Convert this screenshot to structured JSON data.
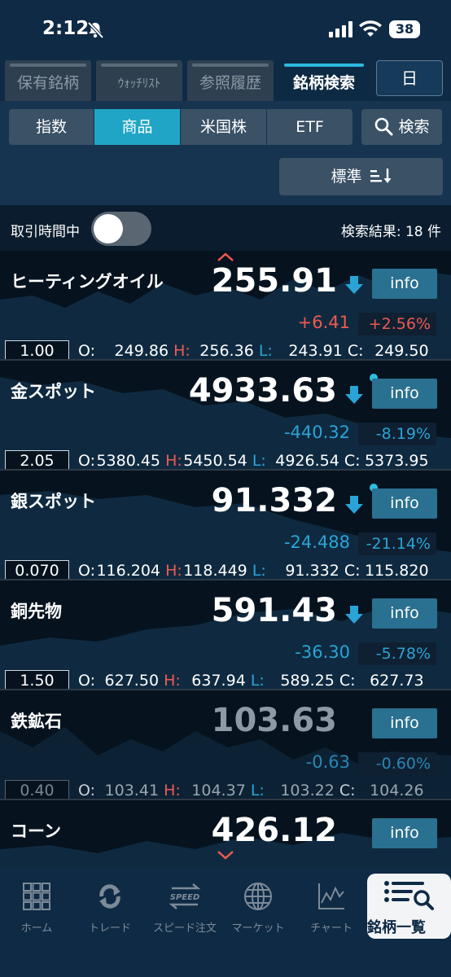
{
  "status_bar": {
    "time": "2:12",
    "battery": "38"
  },
  "tabs": [
    {
      "label": "保有銘柄"
    },
    {
      "label": "ｳｫｯﾁﾘｽﾄ"
    },
    {
      "label": "参照履歴"
    },
    {
      "label": "銘柄検索"
    }
  ],
  "day_button": "日",
  "segments": [
    {
      "label": "指数"
    },
    {
      "label": "商品"
    },
    {
      "label": "米国株"
    },
    {
      "label": "ETF"
    }
  ],
  "search_button": "検索",
  "sort_button": "標準",
  "trading_hours_label": "取引時間中",
  "trading_hours_on": false,
  "result_count": "検索結果: 18 件",
  "colors": {
    "up": "#ef5a50",
    "down": "#2aa4d6",
    "accent": "#21a5c6"
  },
  "rows": [
    {
      "name": "ヒーティングオイル",
      "price": "255.91",
      "change": "+6.41",
      "pct": "+2.56%",
      "multiplier": "1.00",
      "o": "249.86",
      "h": "256.36",
      "l": "243.91",
      "c": "249.50",
      "info": "info"
    },
    {
      "name": "金スポット",
      "price": "4933.63",
      "change": "-440.32",
      "pct": "-8.19%",
      "multiplier": "2.05",
      "o": "5380.45",
      "h": "5450.54",
      "l": "4926.54",
      "c": "5373.95",
      "info": "info"
    },
    {
      "name": "銀スポット",
      "price": "91.332",
      "change": "-24.488",
      "pct": "-21.14%",
      "multiplier": "0.070",
      "o": "116.204",
      "h": "118.449",
      "l": "91.332",
      "c": "115.820",
      "info": "info"
    },
    {
      "name": "銅先物",
      "price": "591.43",
      "change": "-36.30",
      "pct": "-5.78%",
      "multiplier": "1.50",
      "o": "627.50",
      "h": "637.94",
      "l": "589.25",
      "c": "627.73",
      "info": "info"
    },
    {
      "name": "鉄鉱石",
      "price": "103.63",
      "change": "-0.63",
      "pct": "-0.60%",
      "multiplier": "0.40",
      "o": "103.41",
      "h": "104.37",
      "l": "103.22",
      "c": "104.26",
      "info": "info"
    },
    {
      "name": "コーン",
      "price": "426.12",
      "info": "info"
    }
  ],
  "ohlc_keys": {
    "o": "O:",
    "h": "H:",
    "l": "L:",
    "c": "C:"
  },
  "bottom_nav": [
    {
      "label": "ホーム",
      "icon": "home-grid-icon"
    },
    {
      "label": "トレード",
      "icon": "trade-arrows-icon"
    },
    {
      "label": "スピード注文",
      "icon": "speed-icon"
    },
    {
      "label": "マーケット",
      "icon": "globe-icon"
    },
    {
      "label": "チャート",
      "icon": "chart-icon"
    },
    {
      "label": "銘柄一覧",
      "icon": "list-search-icon"
    }
  ],
  "speed_icon_text": "SPEED"
}
